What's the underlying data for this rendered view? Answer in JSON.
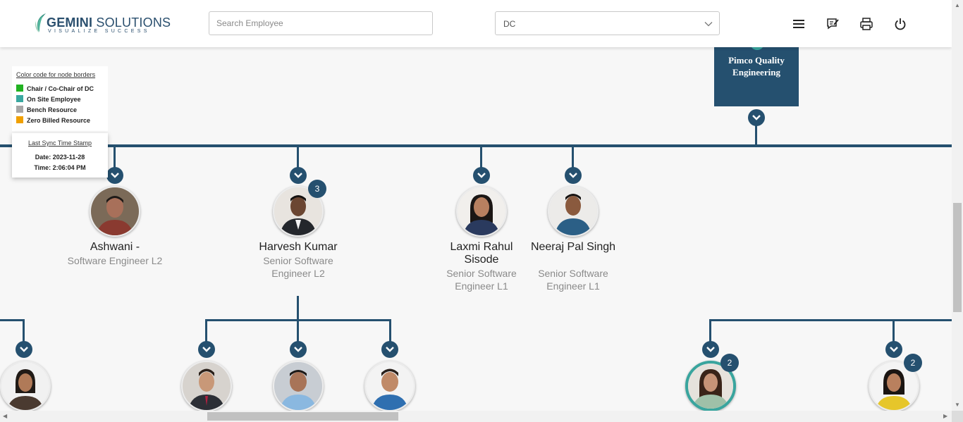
{
  "header": {
    "logo_name_bold": "GEMINI",
    "logo_name_rest": " SOLUTIONS",
    "logo_tagline": "VISUALIZE SUCCESS",
    "search_placeholder": "Search Employee",
    "dc_select_value": "DC",
    "icons": [
      "menu-icon",
      "feedback-icon",
      "print-icon",
      "power-icon"
    ]
  },
  "legend": {
    "title": "Color code for node borders",
    "items": [
      {
        "label": "Chair / Co-Chair of DC",
        "color": "#22b222"
      },
      {
        "label": "On Site Employee",
        "color": "#3aa8a0"
      },
      {
        "label": "Bench Resource",
        "color": "#a6a6a6"
      },
      {
        "label": "Zero Billed Resource",
        "color": "#f0a000"
      }
    ]
  },
  "sync": {
    "title": "Last Sync Time Stamp",
    "date": "Date: 2023-11-28",
    "time": "Time: 2:06:04 PM"
  },
  "top_node": {
    "label": "Pimco Quality Engineering"
  },
  "colors": {
    "tree_line": "#25506f",
    "badge": "#25506f",
    "on_site_border": "#39a59e"
  },
  "employees": [
    {
      "name": "Ashwani -",
      "title": "Software Engineer L2",
      "badge": null
    },
    {
      "name": "Harvesh Kumar",
      "title": "Senior Software Engineer L2",
      "badge": "3"
    },
    {
      "name": "Laxmi Rahul Sisode",
      "title": "Senior Software Engineer L1",
      "badge": null
    },
    {
      "name": "Neeraj Pal Singh",
      "title": "Senior Software Engineer L1",
      "badge": null
    }
  ],
  "lower_nodes": [
    {
      "badge": null
    },
    {
      "badge": null
    },
    {
      "badge": null
    },
    {
      "badge": null
    },
    {
      "badge": "2"
    },
    {
      "badge": "2"
    }
  ]
}
